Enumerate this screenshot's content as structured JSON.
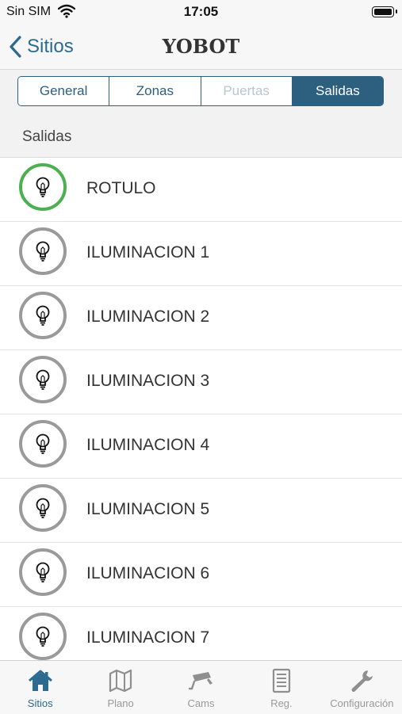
{
  "status_bar": {
    "carrier": "Sin SIM",
    "time": "17:05"
  },
  "nav": {
    "back_label": "Sitios",
    "title": "YOBOT"
  },
  "segments": [
    {
      "label": "General",
      "state": "normal"
    },
    {
      "label": "Zonas",
      "state": "normal"
    },
    {
      "label": "Puertas",
      "state": "disabled"
    },
    {
      "label": "Salidas",
      "state": "selected"
    }
  ],
  "section_header": "Salidas",
  "outputs": [
    {
      "name": "ROTULO",
      "on": true
    },
    {
      "name": "ILUMINACION 1",
      "on": false
    },
    {
      "name": "ILUMINACION 2",
      "on": false
    },
    {
      "name": "ILUMINACION 3",
      "on": false
    },
    {
      "name": "ILUMINACION 4",
      "on": false
    },
    {
      "name": "ILUMINACION 5",
      "on": false
    },
    {
      "name": "ILUMINACION 6",
      "on": false
    },
    {
      "name": "ILUMINACION 7",
      "on": false
    }
  ],
  "tabbar": [
    {
      "label": "Sitios",
      "icon": "house-icon",
      "active": true
    },
    {
      "label": "Plano",
      "icon": "map-icon",
      "active": false
    },
    {
      "label": "Cams",
      "icon": "camera-icon",
      "active": false
    },
    {
      "label": "Reg.",
      "icon": "log-icon",
      "active": false
    },
    {
      "label": "Configuración",
      "icon": "wrench-icon",
      "active": false
    }
  ],
  "colors": {
    "accent": "#2d5f7f",
    "on": "#4caf50",
    "off": "#9a9a9a"
  }
}
